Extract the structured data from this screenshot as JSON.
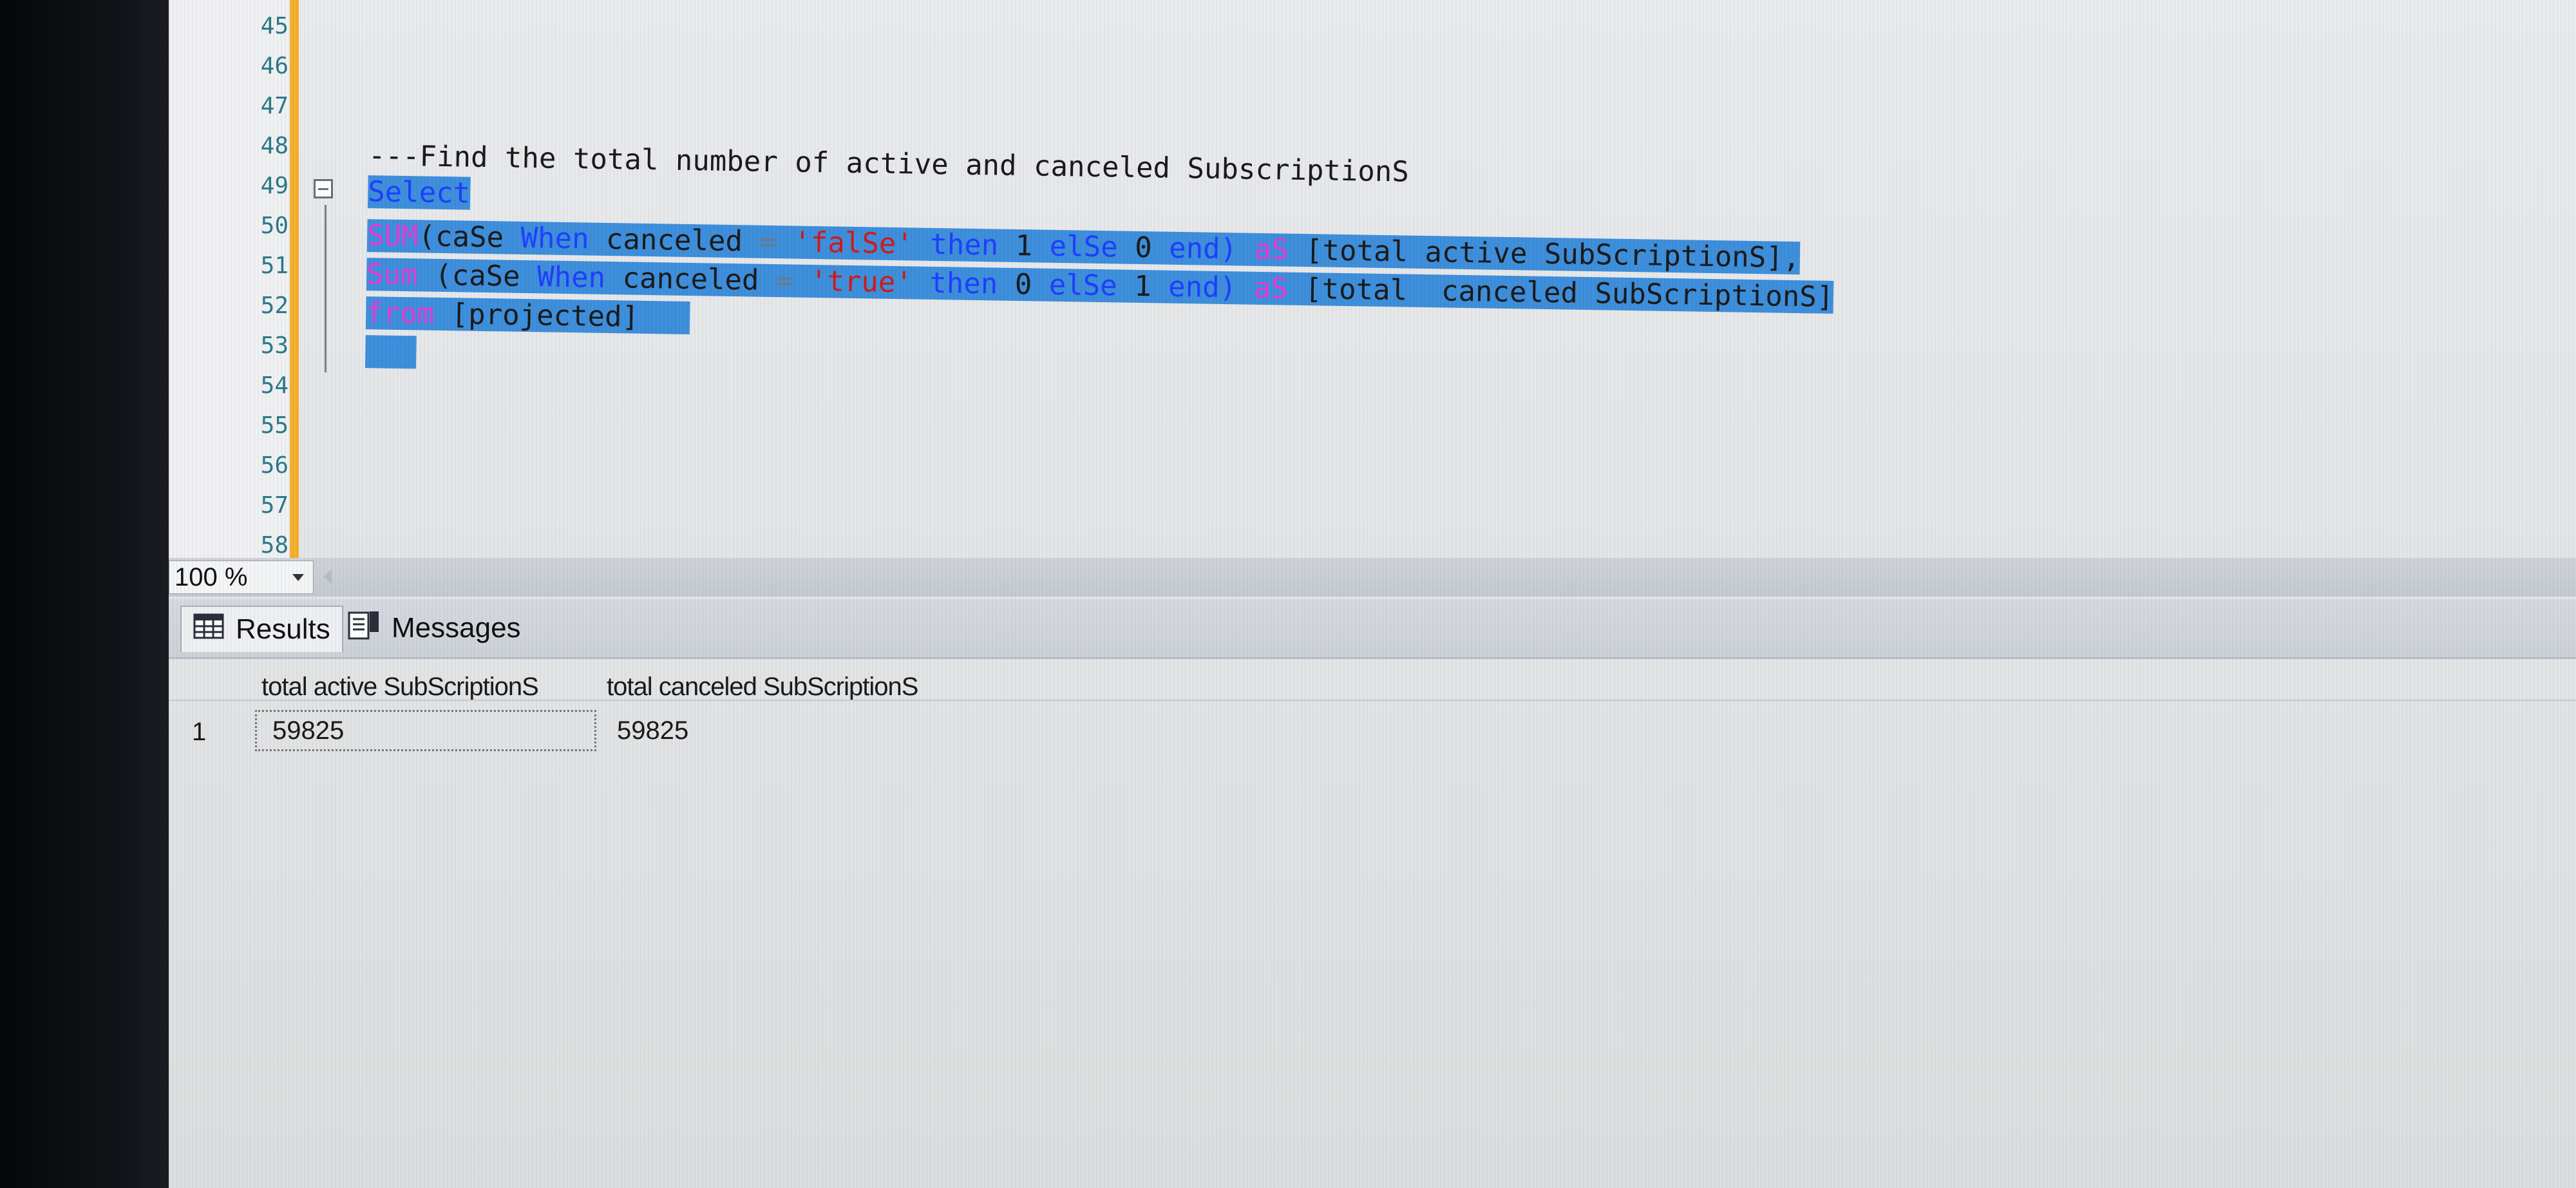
{
  "editor": {
    "line_numbers": [
      "45",
      "46",
      "47",
      "48",
      "49",
      "50",
      "51",
      "52",
      "53",
      "54",
      "55",
      "56",
      "57",
      "58"
    ],
    "comment": "---Find the total number of active and canceled SubscriptionS",
    "line49": {
      "kw": "Select"
    },
    "line50": {
      "fn": "SUM",
      "p1": "(caSe ",
      "kw1": "When",
      "p2": " canceled ",
      "op": "=",
      "sp": " ",
      "str": "'falSe'",
      "sp2": " ",
      "kw2": "then",
      "p3": " 1 ",
      "kw3": "elSe",
      "p4": " 0 ",
      "kw4": "end)",
      "sp3": " ",
      "kw5": "aS",
      "p5": " [total active SubScriptionS],"
    },
    "line51": {
      "fn": "Sum",
      "p1": " (caSe ",
      "kw1": "When",
      "p2": " canceled ",
      "op": "=",
      "sp": " ",
      "str": "'true'",
      "sp2": " ",
      "kw2": "then",
      "p3": " 0 ",
      "kw3": "elSe",
      "p4": " 1 ",
      "kw4": "end)",
      "sp3": " ",
      "kw5": "aS",
      "p5": " [total  canceled SubScriptionS]"
    },
    "line52": {
      "kw": "from",
      "p": " [projected]"
    }
  },
  "zoom": {
    "value": "100 %"
  },
  "tabs": {
    "results": "Results",
    "messages": "Messages"
  },
  "results": {
    "columns": [
      "total active SubScriptionS",
      "total  canceled SubScriptionS"
    ],
    "rows": [
      {
        "num": "1",
        "cells": [
          "59825",
          "59825"
        ]
      }
    ]
  }
}
